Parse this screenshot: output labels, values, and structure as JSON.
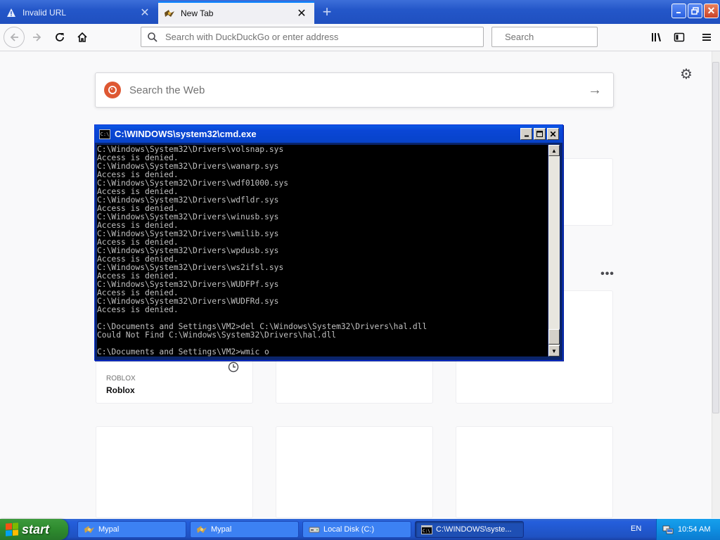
{
  "browser": {
    "tabs": [
      {
        "label": "Invalid URL",
        "state": "inactive"
      },
      {
        "label": "New Tab",
        "state": "active"
      }
    ],
    "urlbar_placeholder": "Search with DuckDuckGo or enter address",
    "searchbar_placeholder": "Search",
    "accent_color": "#0a84ff"
  },
  "newtab": {
    "web_search_placeholder": "Search the Web",
    "top_site": {
      "host": "ROBLOX",
      "title": "Roblox"
    }
  },
  "cmd": {
    "title": "C:\\WINDOWS\\system32\\cmd.exe",
    "lines": [
      "C:\\Windows\\System32\\Drivers\\volsnap.sys",
      "Access is denied.",
      "C:\\Windows\\System32\\Drivers\\wanarp.sys",
      "Access is denied.",
      "C:\\Windows\\System32\\Drivers\\wdf01000.sys",
      "Access is denied.",
      "C:\\Windows\\System32\\Drivers\\wdfldr.sys",
      "Access is denied.",
      "C:\\Windows\\System32\\Drivers\\winusb.sys",
      "Access is denied.",
      "C:\\Windows\\System32\\Drivers\\wmilib.sys",
      "Access is denied.",
      "C:\\Windows\\System32\\Drivers\\wpdusb.sys",
      "Access is denied.",
      "C:\\Windows\\System32\\Drivers\\ws2ifsl.sys",
      "Access is denied.",
      "C:\\Windows\\System32\\Drivers\\WUDFPf.sys",
      "Access is denied.",
      "C:\\Windows\\System32\\Drivers\\WUDFRd.sys",
      "Access is denied.",
      "",
      "C:\\Documents and Settings\\VM2>del C:\\Windows\\System32\\Drivers\\hal.dll",
      "Could Not Find C:\\Windows\\System32\\Drivers\\hal.dll",
      "",
      "C:\\Documents and Settings\\VM2>wmic o"
    ]
  },
  "taskbar": {
    "start_label": "start",
    "tasks": [
      {
        "label": "Mypal",
        "icon": "mypal-icon",
        "active": false
      },
      {
        "label": "Mypal",
        "icon": "mypal-icon",
        "active": false
      },
      {
        "label": "Local Disk (C:)",
        "icon": "drive-icon",
        "active": false
      },
      {
        "label": "C:\\WINDOWS\\syste...",
        "icon": "cmd-icon",
        "active": true
      }
    ],
    "language": "EN",
    "clock": "10:54 AM"
  }
}
